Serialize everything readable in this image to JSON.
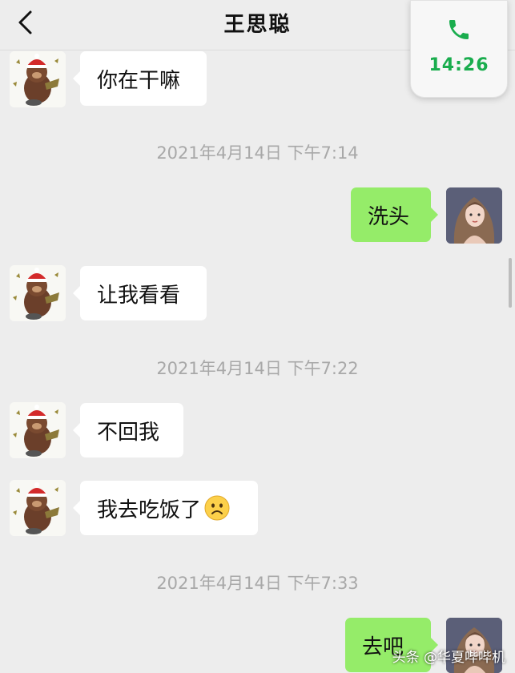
{
  "header": {
    "title": "王思聪"
  },
  "call_widget": {
    "time": "14:26",
    "color": "#1aad4e"
  },
  "messages": [
    {
      "side": "left",
      "text": "你在干嘛"
    },
    {
      "timestamp": "2021年4月14日 下午7:14"
    },
    {
      "side": "right",
      "text": "洗头"
    },
    {
      "side": "left",
      "text": "让我看看"
    },
    {
      "timestamp": "2021年4月14日 下午7:22"
    },
    {
      "side": "left",
      "text": "不回我"
    },
    {
      "side": "left",
      "text": "我去吃饭了",
      "emoji": "frowning-face-emoji"
    },
    {
      "timestamp": "2021年4月14日 下午7:33"
    },
    {
      "side": "right",
      "text": "去吧"
    }
  ],
  "watermark": "头条 @华夏哔哔机",
  "colors": {
    "background": "#ededed",
    "bubble_left": "#ffffff",
    "bubble_right": "#95ec69",
    "timestamp": "#a8a8a8"
  }
}
